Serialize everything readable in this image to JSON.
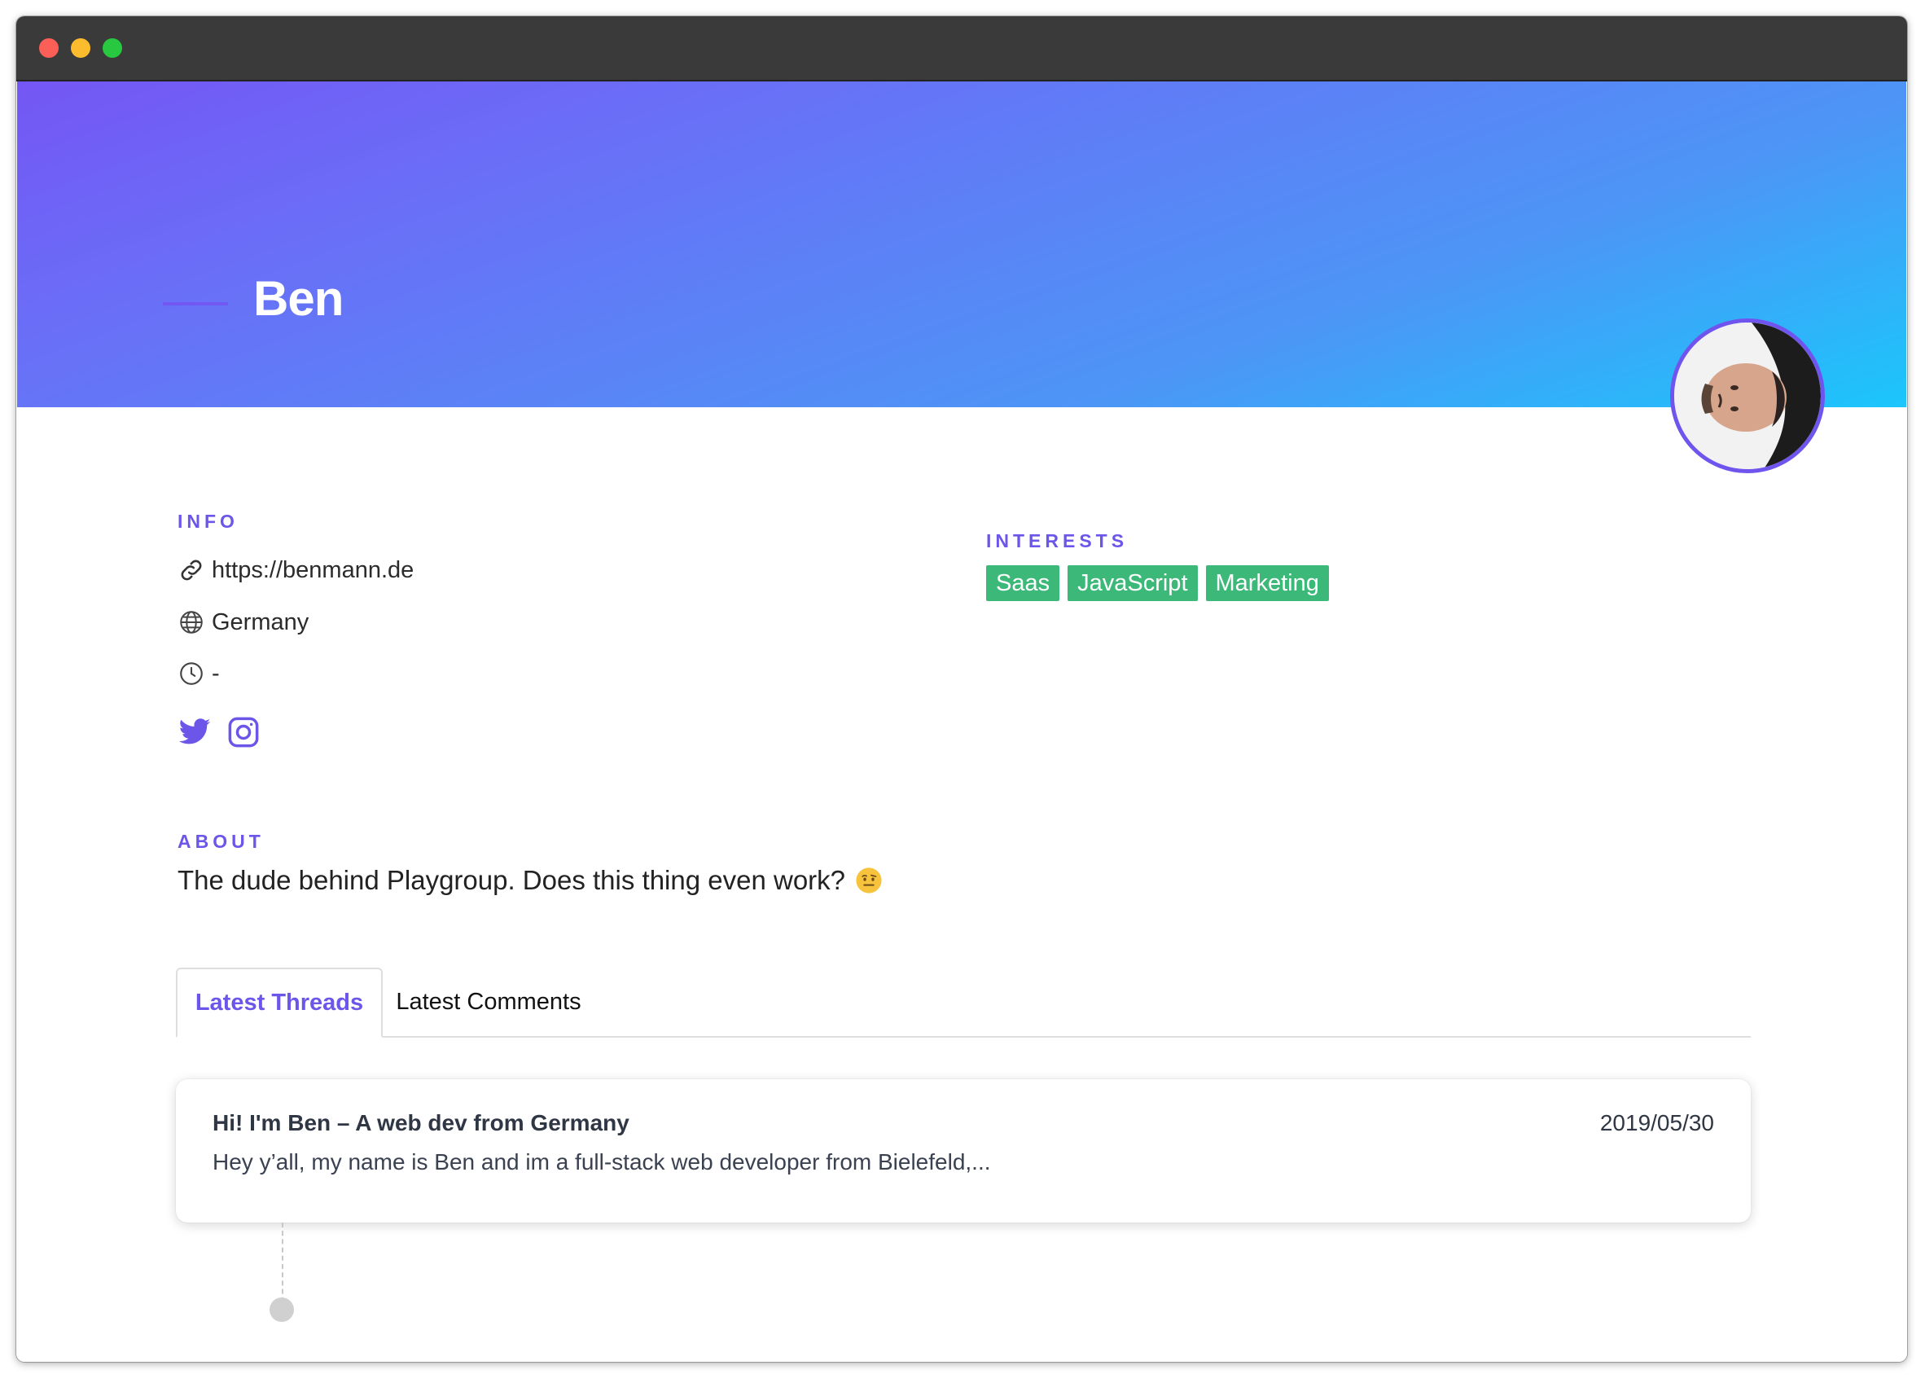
{
  "profile": {
    "name": "Ben"
  },
  "info": {
    "label": "INFO",
    "website": "https://benmann.de",
    "location": "Germany",
    "time": "-",
    "icons": [
      "link-icon",
      "globe-icon",
      "clock-icon",
      "twitter-icon",
      "instagram-icon"
    ]
  },
  "interests": {
    "label": "INTERESTS",
    "tags": [
      "Saas",
      "JavaScript",
      "Marketing"
    ]
  },
  "about": {
    "label": "ABOUT",
    "text": "The dude behind Playgroup. Does this thing even work?",
    "emoji": "raised-eyebrow-emoji"
  },
  "tabs": {
    "threads": "Latest Threads",
    "comments": "Latest Comments",
    "active": "threads"
  },
  "threads": [
    {
      "title": "Hi! I'm Ben – A web dev from Germany",
      "date": "2019/05/30",
      "excerpt": "Hey y’all, my name is Ben and im a full-stack web developer from Bielefeld,..."
    }
  ],
  "colors": {
    "accent": "#6c56ea",
    "tag_bg": "#3cb878",
    "hero_start": "#7456f4",
    "hero_end": "#1bc6fb"
  }
}
